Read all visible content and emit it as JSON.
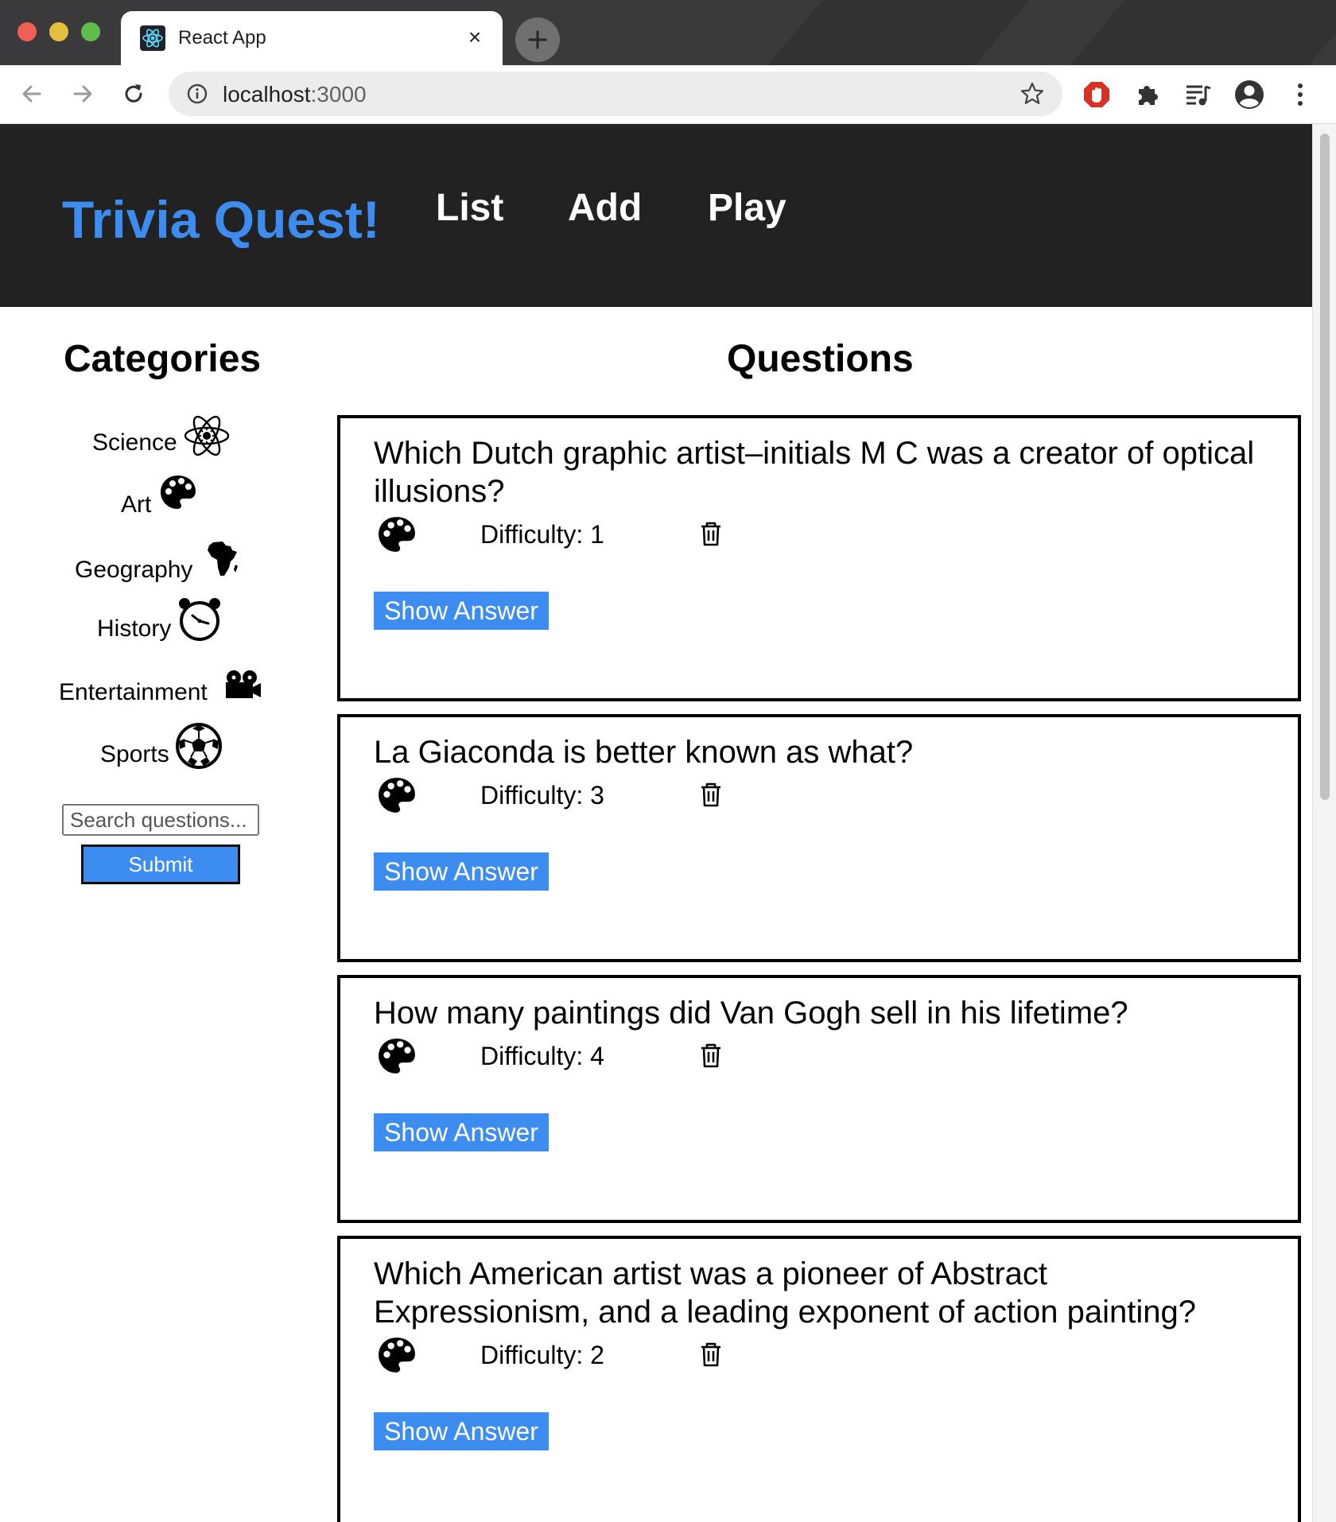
{
  "browser": {
    "tab_title": "React App",
    "tab_close": "×",
    "url_host": "localhost",
    "url_port": ":3000"
  },
  "app": {
    "brand": "Trivia Quest!",
    "nav": [
      "List",
      "Add",
      "Play"
    ]
  },
  "categories": {
    "heading": "Categories",
    "items": [
      {
        "label": "Science",
        "icon": "atom-icon"
      },
      {
        "label": "Art",
        "icon": "palette-icon"
      },
      {
        "label": "Geography",
        "icon": "africa-icon"
      },
      {
        "label": "History",
        "icon": "alarm-clock-icon"
      },
      {
        "label": "Entertainment",
        "icon": "film-projector-icon"
      },
      {
        "label": "Sports",
        "icon": "soccer-ball-icon"
      }
    ],
    "search_placeholder": "Search questions...",
    "submit_label": "Submit"
  },
  "questions": {
    "heading": "Questions",
    "difficulty_prefix": "Difficulty: ",
    "items": [
      {
        "text": "Which Dutch graphic artist–initials M C was a creator of optical illusions?",
        "category_icon": "palette-icon",
        "difficulty": "Difficulty: 1",
        "button": "Show Answer"
      },
      {
        "text": "La Giaconda is better known as what?",
        "category_icon": "palette-icon",
        "difficulty": "Difficulty: 3",
        "button": "Show Answer"
      },
      {
        "text": "How many paintings did Van Gogh sell in his lifetime?",
        "category_icon": "palette-icon",
        "difficulty": "Difficulty: 4",
        "button": "Show Answer"
      },
      {
        "text": "Which American artist was a pioneer of Abstract Expressionism, and a leading exponent of action painting?",
        "category_icon": "palette-icon",
        "difficulty": "Difficulty: 2",
        "button": "Show Answer"
      }
    ]
  },
  "colors": {
    "accent": "#3d8cf0",
    "header_bg": "#222222"
  }
}
